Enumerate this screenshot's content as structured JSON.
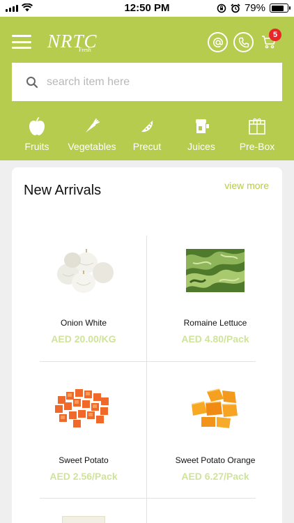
{
  "status_bar": {
    "time": "12:50 PM",
    "battery": "79%",
    "battery_level": 0.79
  },
  "header": {
    "logo": "NRTC",
    "logo_sub": "Fresh",
    "cart_count": "5",
    "brand_color": "#b5cc4e"
  },
  "search": {
    "placeholder": "search item here",
    "value": ""
  },
  "categories": [
    {
      "label": "Fruits",
      "icon": "apple-icon"
    },
    {
      "label": "Vegetables",
      "icon": "carrot-icon"
    },
    {
      "label": "Precut",
      "icon": "watermelon-slice-icon"
    },
    {
      "label": "Juices",
      "icon": "juicer-icon"
    },
    {
      "label": "Pre-Box",
      "icon": "gift-box-icon"
    }
  ],
  "section": {
    "title": "New Arrivals",
    "view_more": "view more"
  },
  "products": [
    {
      "name": "Onion White",
      "price": "AED 20.00/KG",
      "image": "white-onions"
    },
    {
      "name": "Romaine Lettuce",
      "price": "AED 4.80/Pack",
      "image": "romaine-lettuce"
    },
    {
      "name": "Sweet Potato",
      "price": "AED 2.56/Pack",
      "image": "diced-sweet-potato"
    },
    {
      "name": "Sweet Potato Orange",
      "price": "AED 6.27/Pack",
      "image": "sweet-potato-orange-chunks"
    }
  ]
}
